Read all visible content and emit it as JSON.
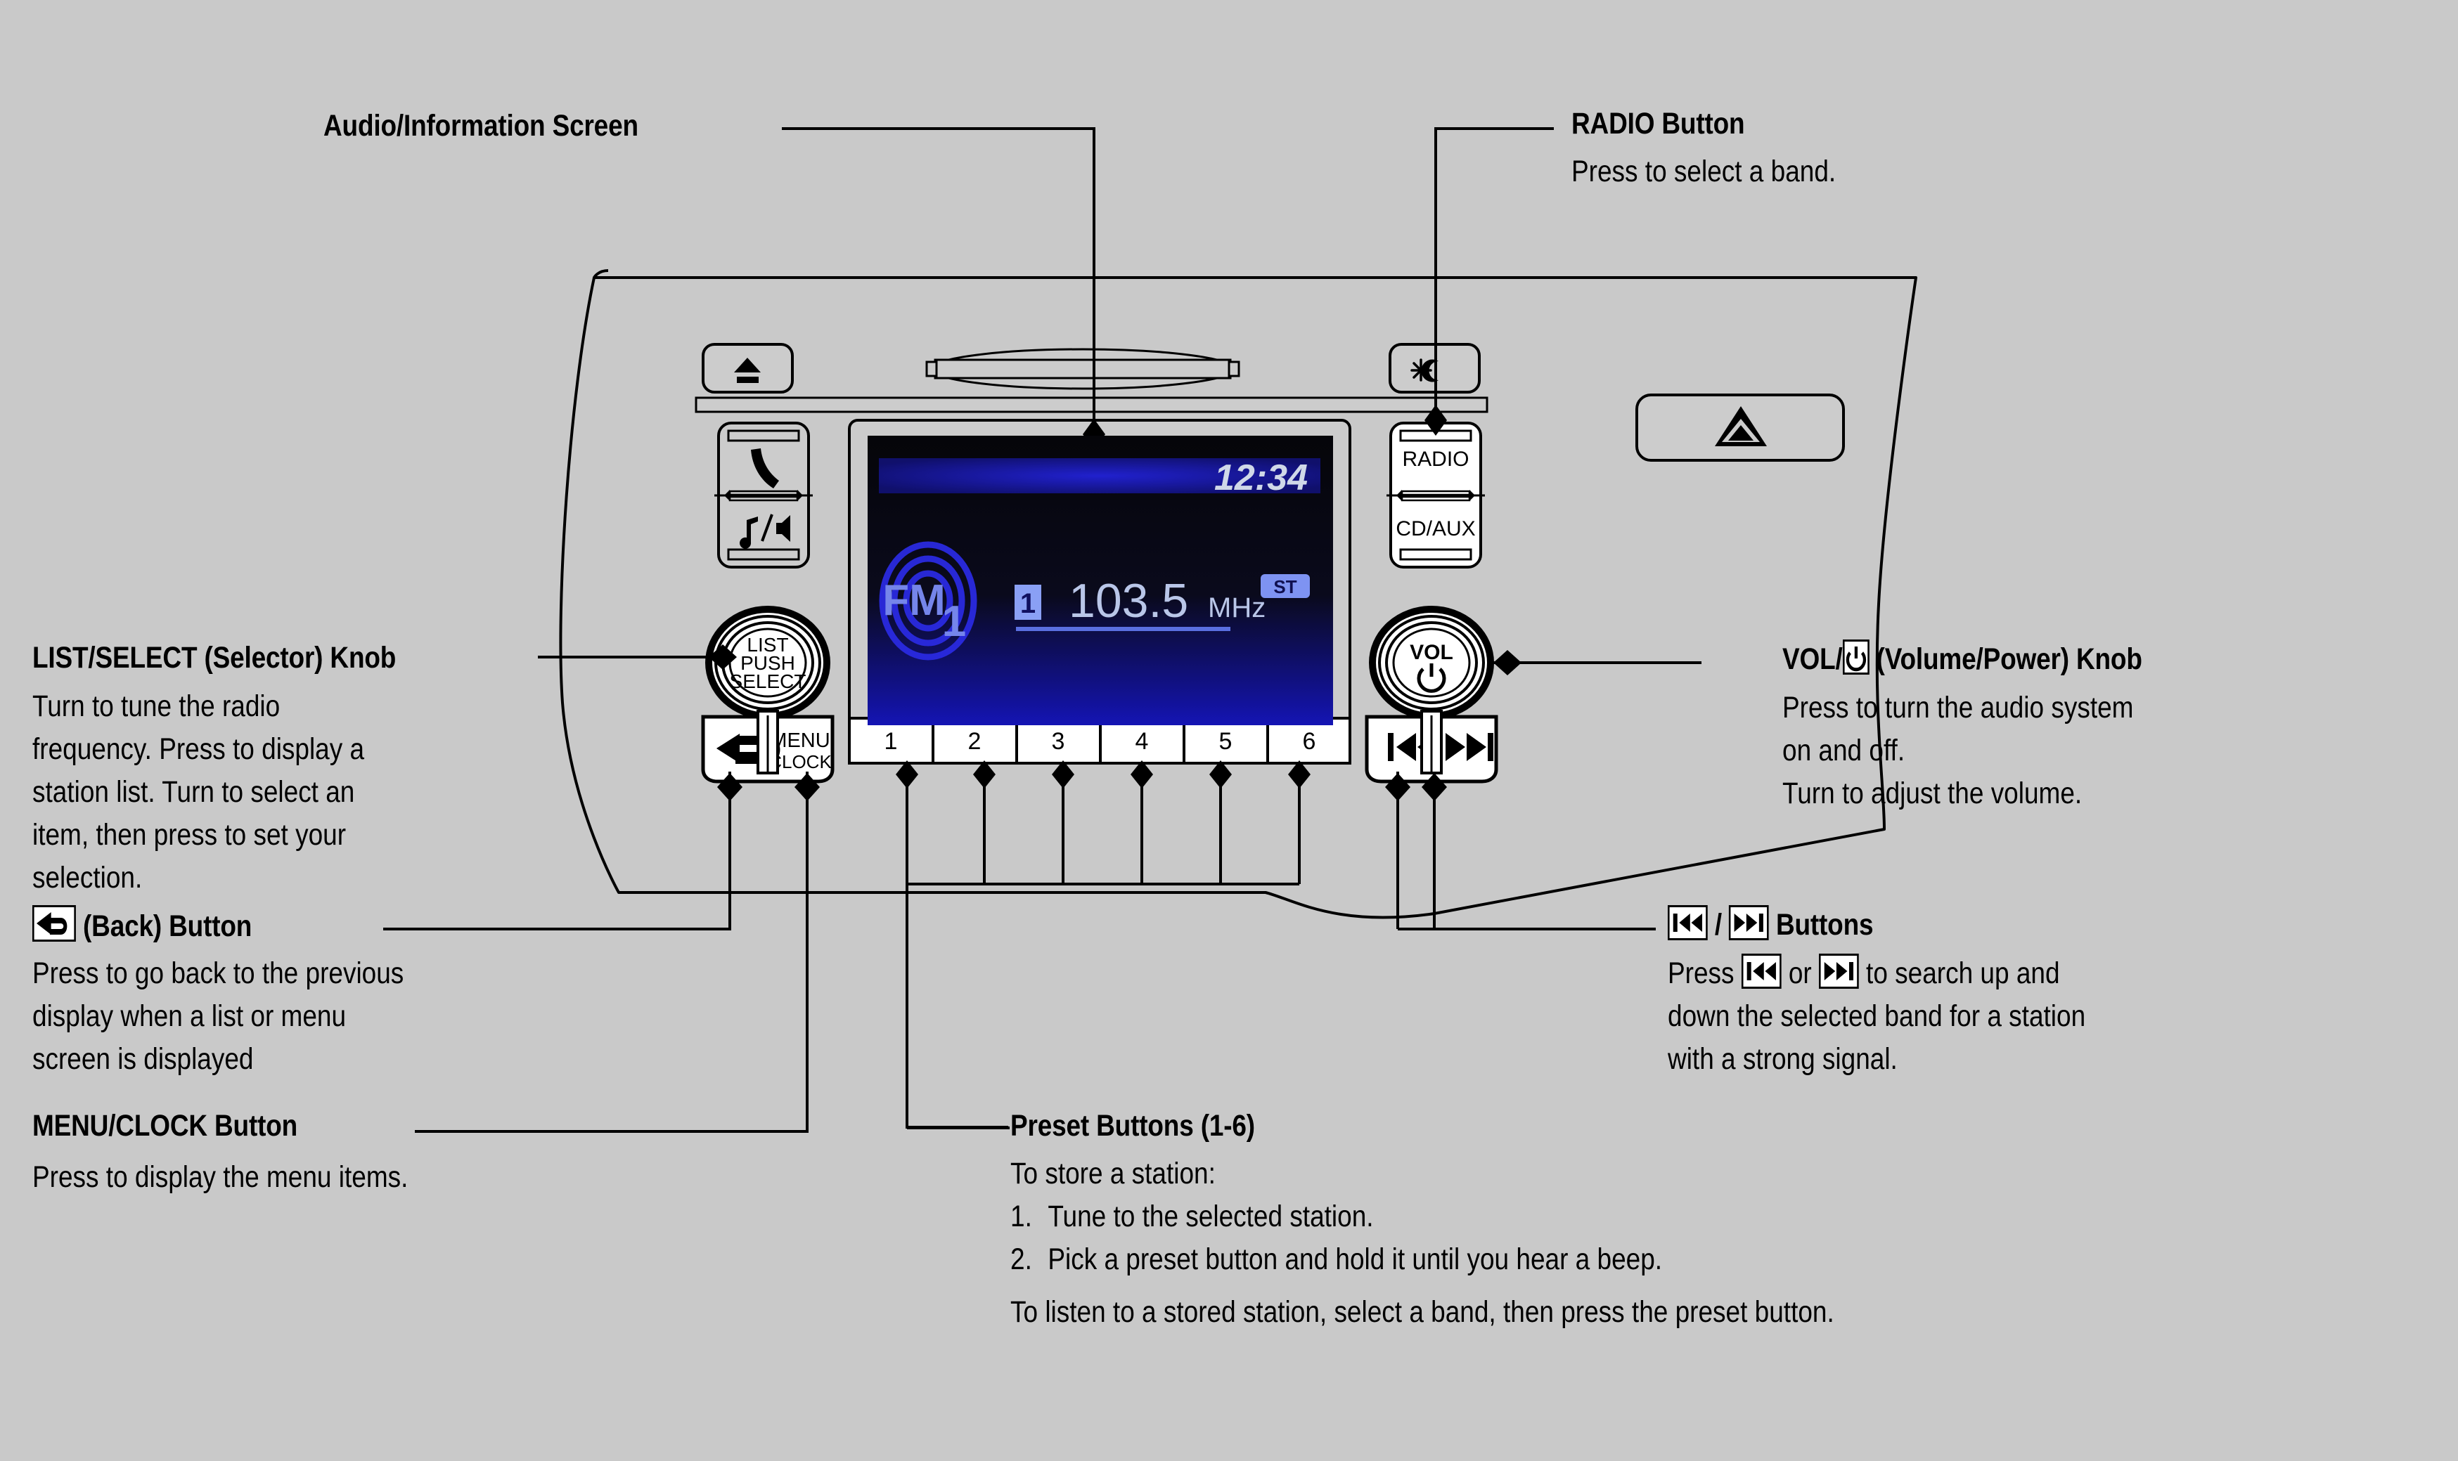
{
  "figure": {
    "background_color": "#c9c9c9",
    "title_screen_label": "Audio/Information Screen",
    "panel_outline_color": "#000000"
  },
  "callouts": {
    "audio_screen": {
      "heading": "Audio/Information Screen",
      "body": []
    },
    "radio_button": {
      "heading": "RADIO Button",
      "body": [
        "Press to select a band."
      ]
    },
    "list_select_knob": {
      "heading": "LIST/SELECT (Selector) Knob",
      "body": [
        "Turn to tune the radio",
        "frequency. Press to display a",
        "station list. Turn to select an",
        "item, then press to set your",
        "selection."
      ]
    },
    "back_button": {
      "heading_icon": "back-arrow-icon",
      "heading": "(Back) Button",
      "body": [
        "Press to go back to the previous",
        "display when a list or menu",
        "screen is displayed"
      ]
    },
    "menu_clock_button": {
      "heading": "MENU/CLOCK Button",
      "body": [
        "Press to display the menu items."
      ]
    },
    "vol_power_knob": {
      "heading_pre": "VOL/",
      "heading_icon": "power-icon",
      "heading_post": "(Volume/Power) Knob",
      "body": [
        "Press to turn the audio system",
        "on and off.",
        "Turn to adjust the volume."
      ]
    },
    "skip_buttons": {
      "heading_icon_prev": "skip-previous-icon",
      "heading_sep": "/",
      "heading_icon_next": "skip-next-icon",
      "heading_post": "Buttons",
      "body_pre": "Press",
      "body_mid": "or",
      "body_post": "to search up and",
      "body_lines": [
        "down the selected band for a station",
        "with a strong signal."
      ]
    },
    "preset_buttons": {
      "heading": "Preset Buttons (1-6)",
      "intro": "To store a station:",
      "steps": [
        {
          "num": "1.",
          "text": "Tune to the selected station."
        },
        {
          "num": "2.",
          "text": "Pick a preset button and hold it until you hear a beep."
        }
      ],
      "footer": "To listen to a stored station, select a band, then press the preset button."
    }
  },
  "head_unit": {
    "eject_button": {
      "icon": "eject-icon"
    },
    "cd_slot": {
      "name": "cd-slot"
    },
    "illumination_button": {
      "icon": "brightness-moon-icon"
    },
    "phone_button": {
      "icon": "phone-icon"
    },
    "audio_source_button": {
      "icon": "music-speaker-icon"
    },
    "radio_rocker": {
      "top_label": "RADIO",
      "bottom_label": "CD/AUX"
    },
    "hazard_button": {
      "icon": "hazard-triangle-icon"
    },
    "selector_knob": {
      "line1": "LIST",
      "line2": "PUSH",
      "line3": "SELECT"
    },
    "vol_knob": {
      "label": "VOL",
      "icon": "power-icon"
    },
    "back_key": {
      "icon": "back-arrow-icon"
    },
    "menu_key": {
      "line1": "MENU",
      "line2": "CLOCK"
    },
    "seek_prev_key": {
      "icon": "skip-previous-icon"
    },
    "seek_next_key": {
      "icon": "skip-next-icon"
    },
    "preset_keys": [
      "1",
      "2",
      "3",
      "4",
      "5",
      "6"
    ]
  },
  "display": {
    "background_color": "#0a0a14",
    "accent_color": "#1a1ac8",
    "text_color": "#cfd8e8",
    "clock": "12:34",
    "band_logo": "FM",
    "band_number": "1",
    "preset_number": "1",
    "frequency": "103.5",
    "frequency_unit": "MHz",
    "stereo_indicator": "ST"
  }
}
